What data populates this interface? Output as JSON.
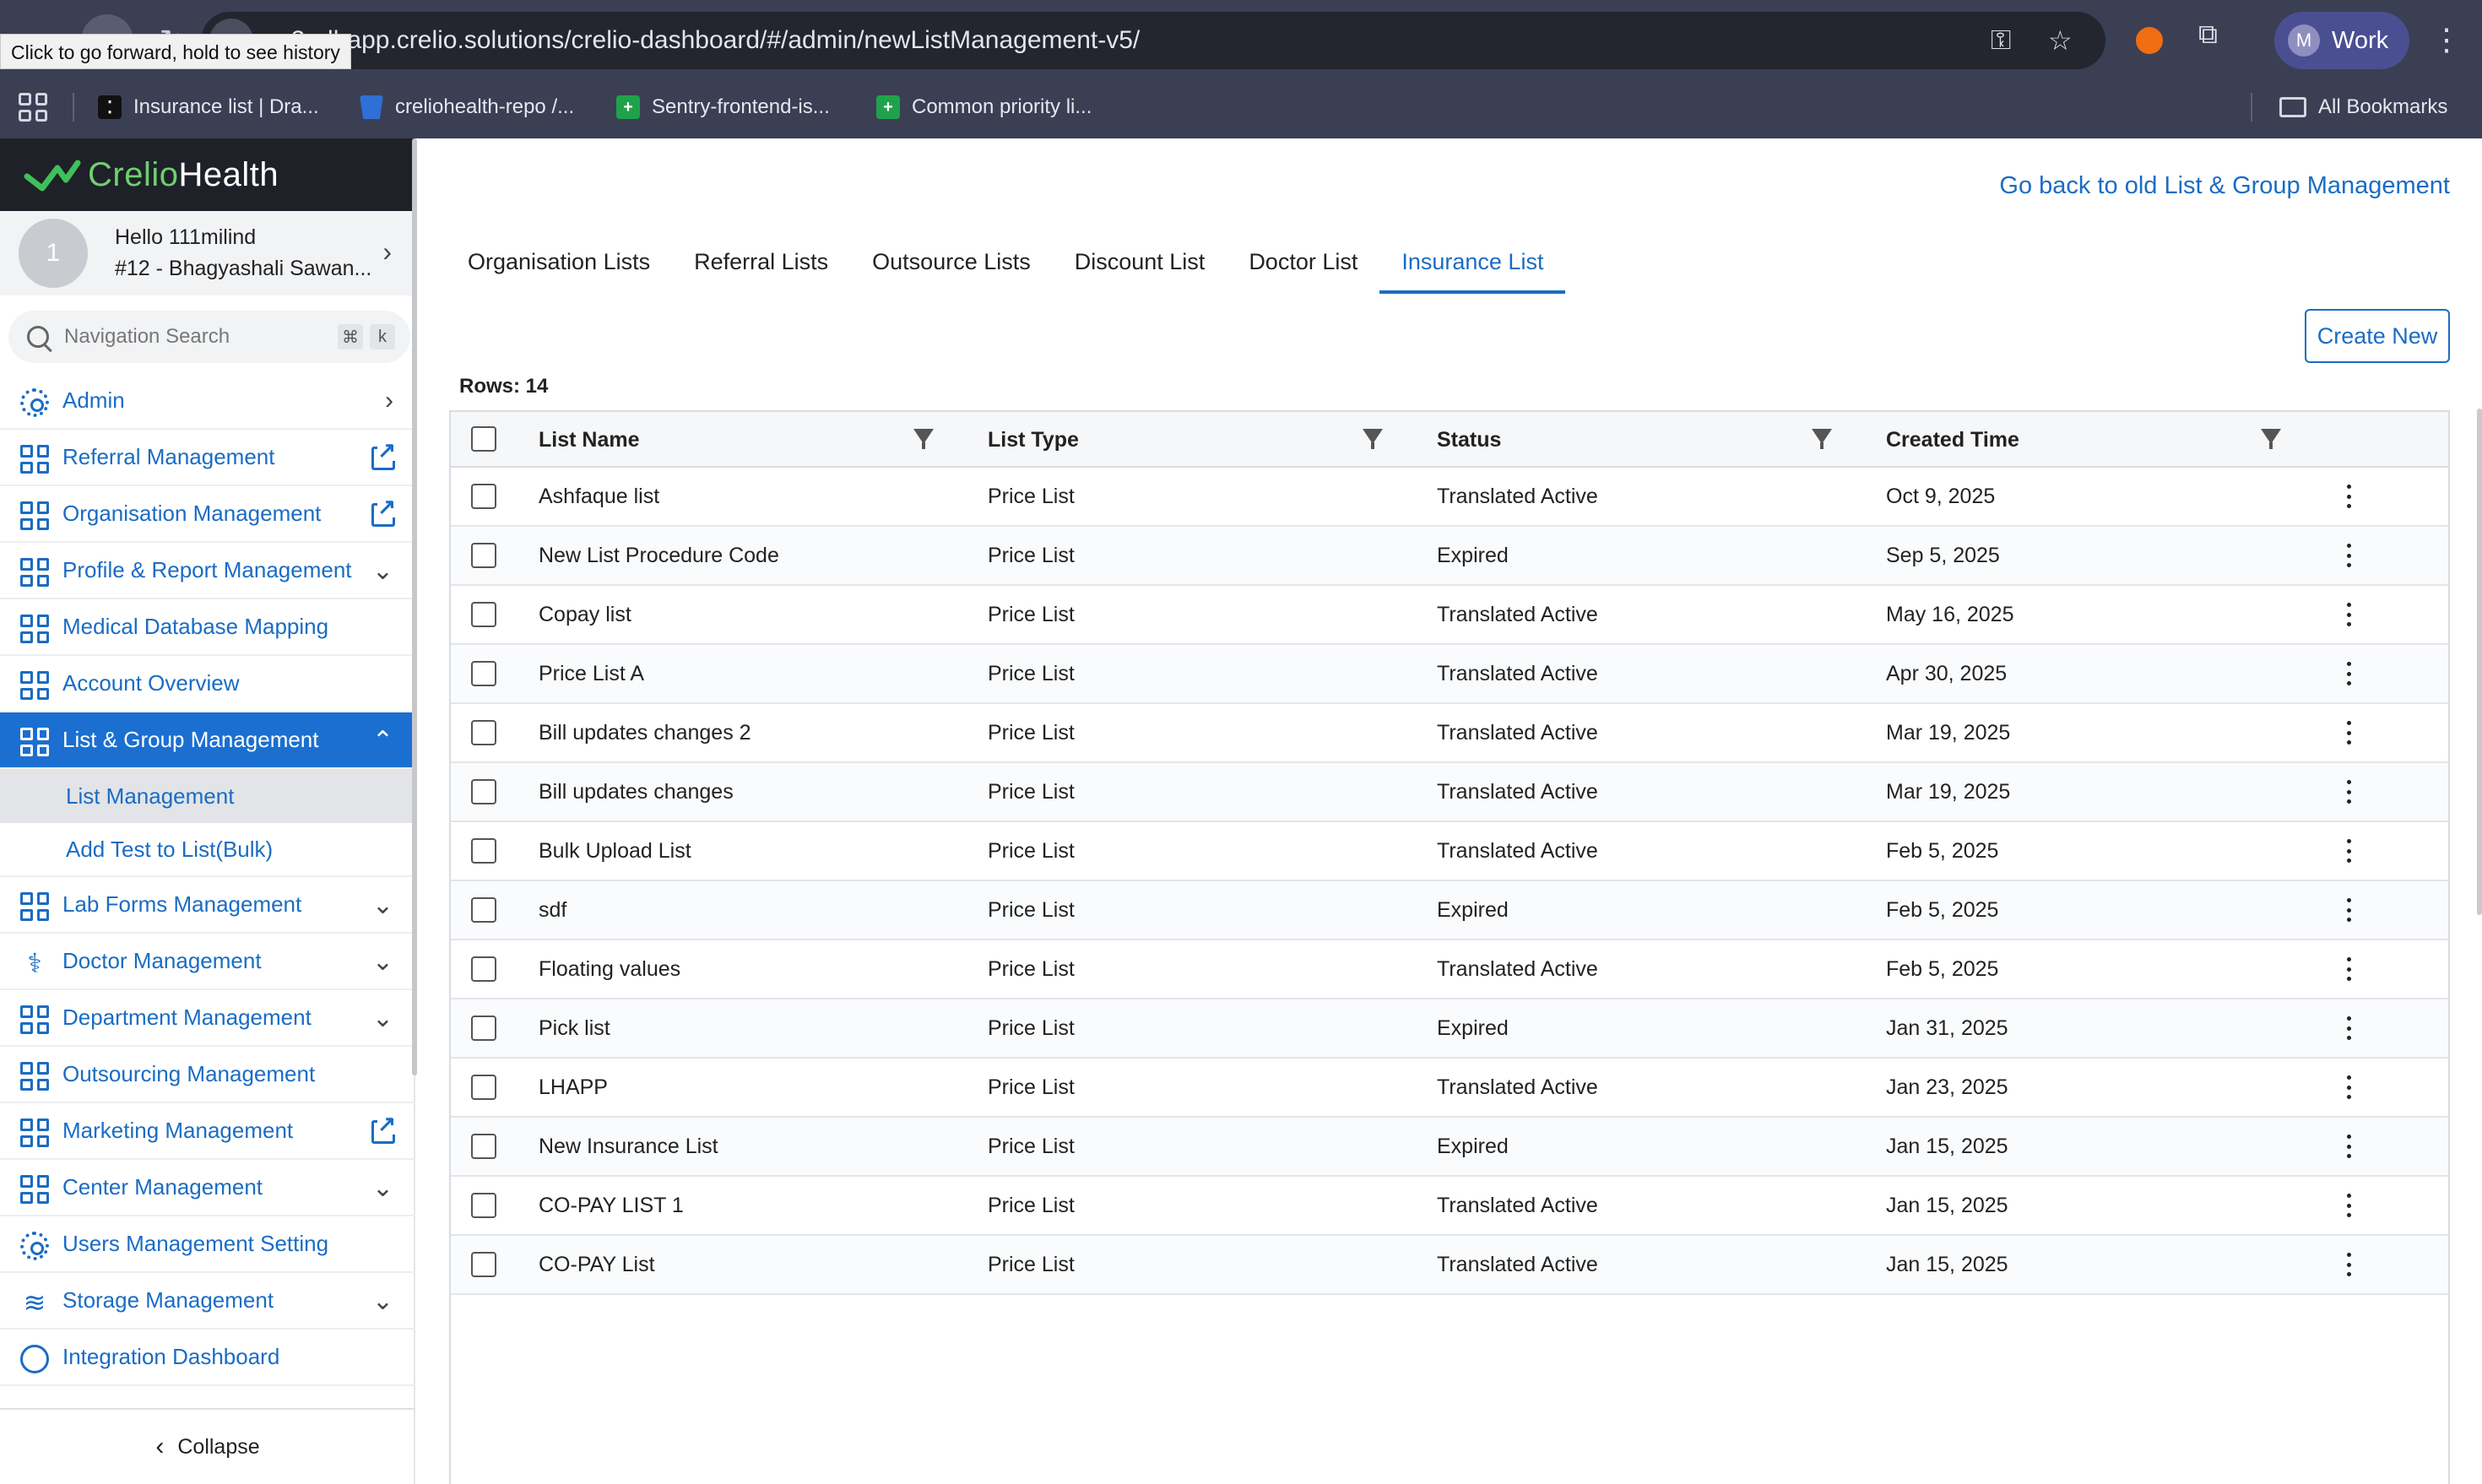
{
  "browser": {
    "tooltip": "Click to go forward, hold to see history",
    "url": "e2e-lhapp.crelio.solutions/crelio-dashboard/#/admin/newListManagement-v5/",
    "profile_initial": "M",
    "profile_label": "Work",
    "bookmarks": [
      {
        "label": "Insurance list | Dra..."
      },
      {
        "label": "creliohealth-repo /..."
      },
      {
        "label": "Sentry-frontend-is..."
      },
      {
        "label": "Common priority li..."
      }
    ],
    "all_bookmarks": "All Bookmarks"
  },
  "sidebar": {
    "logo_a": "Crelio",
    "logo_b": "Health",
    "user": {
      "avatar": "1",
      "greeting": "Hello 111milind",
      "center": "#12 - Bhagyashali Sawan..."
    },
    "search_placeholder": "Navigation Search",
    "shortcut_a": "⌘",
    "shortcut_b": "k",
    "items": [
      {
        "label": "Admin"
      },
      {
        "label": "Referral Management"
      },
      {
        "label": "Organisation Management"
      },
      {
        "label": "Profile & Report Management"
      },
      {
        "label": "Medical Database Mapping"
      },
      {
        "label": "Account Overview"
      },
      {
        "label": "List & Group Management"
      },
      {
        "label": "List Management"
      },
      {
        "label": "Add Test to List(Bulk)"
      },
      {
        "label": "Lab Forms Management"
      },
      {
        "label": "Doctor Management"
      },
      {
        "label": "Department Management"
      },
      {
        "label": "Outsourcing Management"
      },
      {
        "label": "Marketing Management"
      },
      {
        "label": "Center Management"
      },
      {
        "label": "Users Management Setting"
      },
      {
        "label": "Storage Management"
      },
      {
        "label": "Integration Dashboard"
      }
    ],
    "collapse": "Collapse"
  },
  "main": {
    "back_link": "Go back to old List & Group Management",
    "tabs": [
      {
        "label": "Organisation Lists"
      },
      {
        "label": "Referral Lists"
      },
      {
        "label": "Outsource Lists"
      },
      {
        "label": "Discount List"
      },
      {
        "label": "Doctor List"
      },
      {
        "label": "Insurance List"
      }
    ],
    "active_tab": "Insurance List",
    "create_button": "Create New",
    "rows_label": "Rows: 14",
    "columns": [
      "List Name",
      "List Type",
      "Status",
      "Created Time"
    ],
    "rows": [
      {
        "name": "Ashfaque list",
        "type": "Price List",
        "status": "Translated Active",
        "created": "Oct 9, 2025"
      },
      {
        "name": "New List Procedure Code",
        "type": "Price List",
        "status": "Expired",
        "created": "Sep 5, 2025"
      },
      {
        "name": "Copay list",
        "type": "Price List",
        "status": "Translated Active",
        "created": "May 16, 2025"
      },
      {
        "name": "Price List A",
        "type": "Price List",
        "status": "Translated Active",
        "created": "Apr 30, 2025"
      },
      {
        "name": "Bill updates changes 2",
        "type": "Price List",
        "status": "Translated Active",
        "created": "Mar 19, 2025"
      },
      {
        "name": "Bill updates changes",
        "type": "Price List",
        "status": "Translated Active",
        "created": "Mar 19, 2025"
      },
      {
        "name": "Bulk Upload List",
        "type": "Price List",
        "status": "Translated Active",
        "created": "Feb 5, 2025"
      },
      {
        "name": "sdf",
        "type": "Price List",
        "status": "Expired",
        "created": "Feb 5, 2025"
      },
      {
        "name": "Floating values",
        "type": "Price List",
        "status": "Translated Active",
        "created": "Feb 5, 2025"
      },
      {
        "name": "Pick list",
        "type": "Price List",
        "status": "Expired",
        "created": "Jan 31, 2025"
      },
      {
        "name": "LHAPP",
        "type": "Price List",
        "status": "Translated Active",
        "created": "Jan 23, 2025"
      },
      {
        "name": "New Insurance List",
        "type": "Price List",
        "status": "Expired",
        "created": "Jan 15, 2025"
      },
      {
        "name": "CO-PAY LIST 1",
        "type": "Price List",
        "status": "Translated Active",
        "created": "Jan 15, 2025"
      },
      {
        "name": "CO-PAY List",
        "type": "Price List",
        "status": "Translated Active",
        "created": "Jan 15, 2025"
      }
    ]
  },
  "colors": {
    "accent": "#1a6cc4",
    "active_nav_bg": "#1b6fd1",
    "chrome_bg": "#3b3f54",
    "logo_bar": "#1e2128"
  }
}
